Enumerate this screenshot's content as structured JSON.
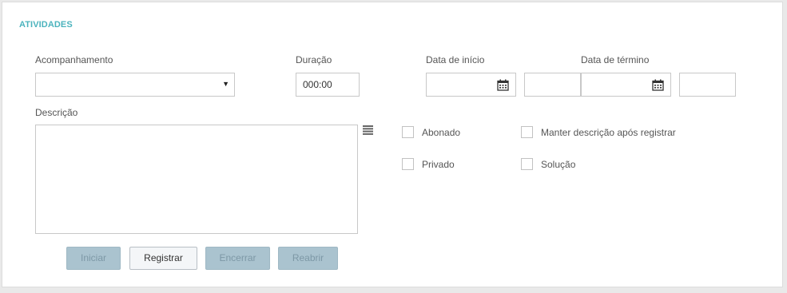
{
  "section": {
    "title": "ATIVIDADES",
    "accent_color": "#4bb3bd"
  },
  "fields": {
    "acompanhamento": {
      "label": "Acompanhamento",
      "value": ""
    },
    "duracao": {
      "label": "Duração",
      "value": "000:00"
    },
    "data_inicio": {
      "label": "Data de início",
      "date_value": "",
      "time_value": ""
    },
    "data_termino": {
      "label": "Data de término",
      "date_value": "",
      "time_value": ""
    },
    "descricao": {
      "label": "Descrição",
      "value": ""
    }
  },
  "icons": {
    "select_arrow": "▼",
    "calendar": "calendar-icon",
    "menu": "menu-icon"
  },
  "checkboxes": [
    {
      "label": "Abonado",
      "checked": false
    },
    {
      "label": "Manter descrição após registrar",
      "checked": false
    },
    {
      "label": "Privado",
      "checked": false
    },
    {
      "label": "Solução",
      "checked": false
    }
  ],
  "buttons": [
    {
      "label": "Iniciar",
      "enabled": false
    },
    {
      "label": "Registrar",
      "enabled": true
    },
    {
      "label": "Encerrar",
      "enabled": false
    },
    {
      "label": "Reabrir",
      "enabled": false
    }
  ]
}
